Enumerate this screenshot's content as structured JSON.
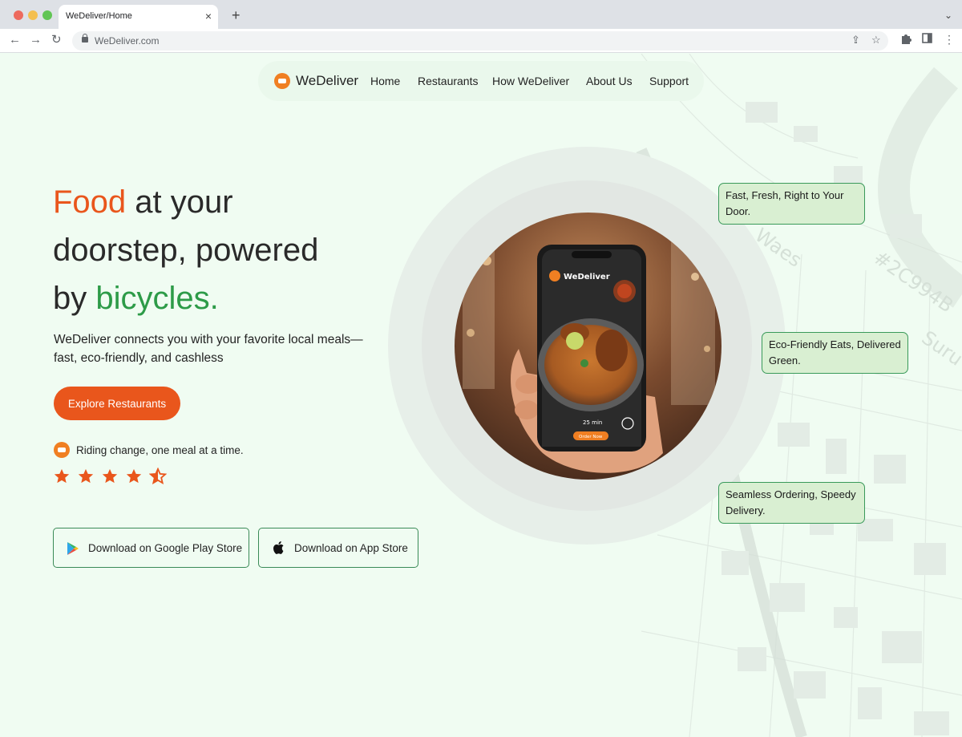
{
  "browser": {
    "tab_title": "WeDeliver/Home",
    "url": "WeDeliver.com"
  },
  "nav": {
    "brand": "WeDeliver",
    "links": [
      "Home",
      "Restaurants",
      "How WeDeliver",
      "About Us",
      "Support"
    ]
  },
  "hero": {
    "title_highlight": "Food",
    "title_part1": "at your",
    "title_part2": "doorstep, powered",
    "title_part3": "by",
    "title_highlight2": "bicycles.",
    "description": "WeDeliver connects you with your favorite local meals—fast, eco-friendly, and cashless",
    "cta_label": "Explore Restaurants",
    "tagline": "Riding change, one meal at a time.",
    "rating": 4.5
  },
  "stores": {
    "google_label": "Download on Google Play Store",
    "apple_label": "Download on App Store"
  },
  "phone": {
    "app_name": "WeDeliver",
    "eta": "25 min",
    "order_label": "Order Now"
  },
  "callouts": [
    "Fast, Fresh, Right to Your Door.",
    "Eco-Friendly Eats, Delivered Green.",
    "Seamless Ordering, Speedy Delivery."
  ],
  "map": {
    "labels": [
      "Waes",
      "#2C994B",
      "Suru"
    ]
  },
  "colors": {
    "accent_orange": "#e9561c",
    "accent_green": "#2d9b48",
    "background": "#f0fcf2"
  }
}
